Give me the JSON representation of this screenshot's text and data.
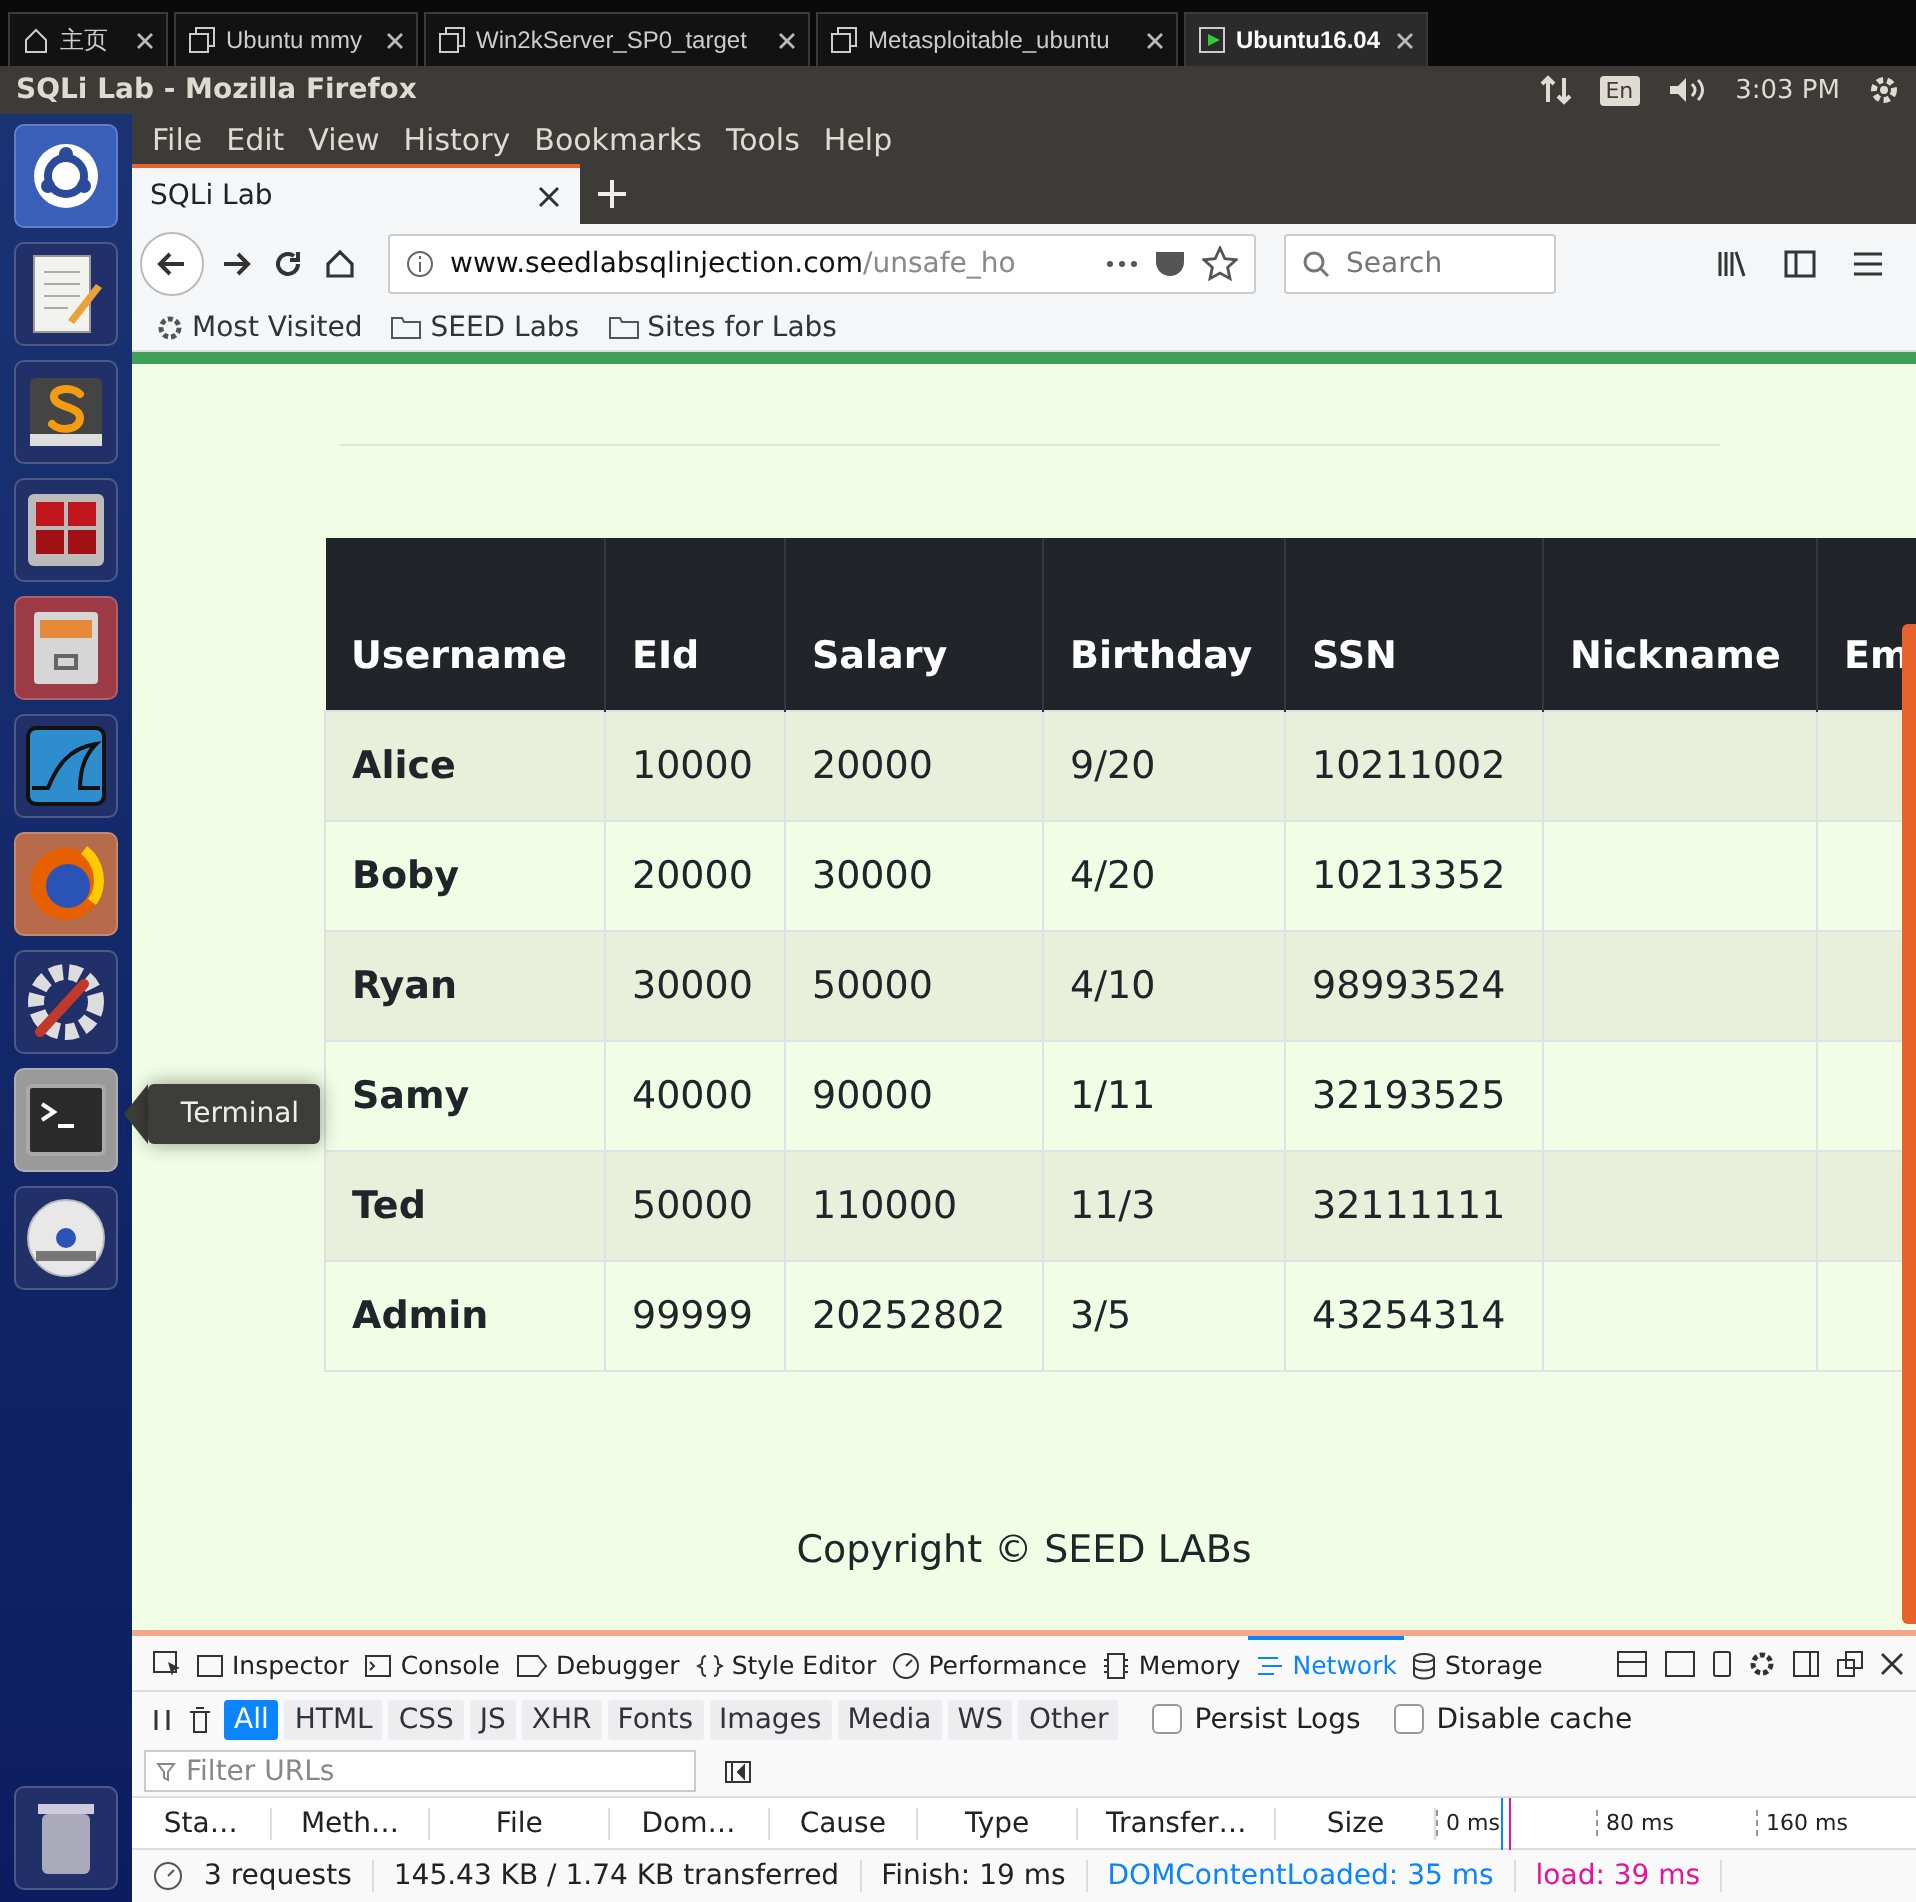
{
  "vm_tabs": [
    {
      "label": "主页",
      "kind": "home",
      "selected": false
    },
    {
      "label": "Ubuntu mmy",
      "kind": "vm",
      "selected": false
    },
    {
      "label": "Win2kServer_SP0_target",
      "kind": "vm",
      "selected": false
    },
    {
      "label": "Metasploitable_ubuntu",
      "kind": "vm",
      "selected": false
    },
    {
      "label": "Ubuntu16.04",
      "kind": "running",
      "selected": true
    }
  ],
  "window": {
    "title": "SQLi Lab - Mozilla Firefox",
    "keyboard": "En",
    "clock": "3:03 PM"
  },
  "launcher": {
    "items": [
      {
        "kind": "dash"
      },
      {
        "kind": "notepad"
      },
      {
        "kind": "code"
      },
      {
        "kind": "grid"
      },
      {
        "kind": "cabinet"
      },
      {
        "kind": "shark"
      },
      {
        "kind": "browser"
      },
      {
        "kind": "settings"
      },
      {
        "kind": "terminal"
      },
      {
        "kind": "disc"
      }
    ],
    "tooltip": "Terminal"
  },
  "menu": [
    "File",
    "Edit",
    "View",
    "History",
    "Bookmarks",
    "Tools",
    "Help"
  ],
  "browser_tabs": [
    {
      "label": "SQLi Lab",
      "selected": true
    }
  ],
  "url": {
    "domain": "www.seedlabsqlinjection.com",
    "path": "/unsafe_ho"
  },
  "search": {
    "placeholder": "Search"
  },
  "bookmarks": [
    {
      "label": "Most Visited",
      "kind": "smart"
    },
    {
      "label": "SEED Labs",
      "kind": "folder"
    },
    {
      "label": "Sites for Labs",
      "kind": "folder"
    }
  ],
  "table": {
    "columns": [
      "Username",
      "EId",
      "Salary",
      "Birthday",
      "SSN",
      "Nickname",
      "Em"
    ],
    "rows": [
      [
        "Alice",
        "10000",
        "20000",
        "9/20",
        "10211002"
      ],
      [
        "Boby",
        "20000",
        "30000",
        "4/20",
        "10213352"
      ],
      [
        "Ryan",
        "30000",
        "50000",
        "4/10",
        "98993524"
      ],
      [
        "Samy",
        "40000",
        "90000",
        "1/11",
        "32193525"
      ],
      [
        "Ted",
        "50000",
        "110000",
        "11/3",
        "32111111"
      ],
      [
        "Admin",
        "99999",
        "20252802",
        "3/5",
        "43254314"
      ]
    ]
  },
  "footer": "Copyright © SEED LABs",
  "devtools": {
    "tools": [
      {
        "label": "Inspector",
        "kind": "inspector",
        "selected": false
      },
      {
        "label": "Console",
        "kind": "console",
        "selected": false
      },
      {
        "label": "Debugger",
        "kind": "debugger",
        "selected": false
      },
      {
        "label": "Style Editor",
        "kind": "style",
        "selected": false
      },
      {
        "label": "Performance",
        "kind": "performance",
        "selected": false
      },
      {
        "label": "Memory",
        "kind": "memory",
        "selected": false
      },
      {
        "label": "Network",
        "kind": "network",
        "selected": true
      },
      {
        "label": "Storage",
        "kind": "storage",
        "selected": false
      }
    ],
    "filters": [
      {
        "label": "All",
        "selected": true
      },
      {
        "label": "HTML",
        "selected": false
      },
      {
        "label": "CSS",
        "selected": false
      },
      {
        "label": "JS",
        "selected": false
      },
      {
        "label": "XHR",
        "selected": false
      },
      {
        "label": "Fonts",
        "selected": false
      },
      {
        "label": "Images",
        "selected": false
      },
      {
        "label": "Media",
        "selected": false
      },
      {
        "label": "WS",
        "selected": false
      },
      {
        "label": "Other",
        "selected": false
      }
    ],
    "options": [
      {
        "label": "Persist Logs",
        "checked": false
      },
      {
        "label": "Disable cache",
        "checked": false
      }
    ],
    "filter": {
      "placeholder": "Filter URLs"
    },
    "columns": [
      "Sta…",
      "Meth…",
      "File",
      "Dom…",
      "Cause",
      "Type",
      "Transfer…",
      "Size"
    ],
    "ticks": [
      "0 ms",
      "80 ms",
      "160 ms"
    ],
    "status": {
      "requests": "3 requests",
      "transferred": "145.43 KB / 1.74 KB transferred",
      "finish": "Finish: 19 ms",
      "dom": "DOMContentLoaded: 35 ms",
      "load": "load: 39 ms"
    }
  }
}
